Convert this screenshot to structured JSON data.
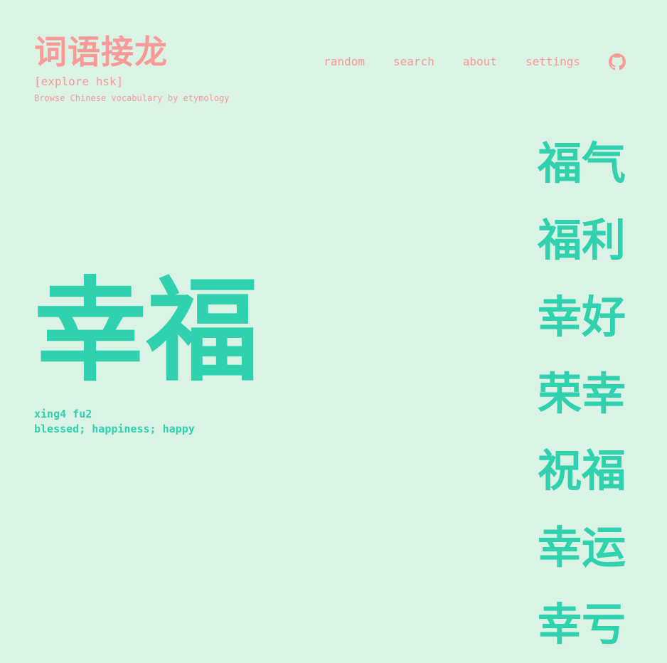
{
  "header": {
    "title": "词语接龙",
    "subtitle": "[explore hsk]",
    "tagline": "Browse Chinese vocabulary by etymology"
  },
  "nav": {
    "items": [
      {
        "label": "random"
      },
      {
        "label": "search"
      },
      {
        "label": "about"
      },
      {
        "label": "settings"
      }
    ],
    "github_icon": "github-icon"
  },
  "word": {
    "characters": "幸福",
    "pinyin": "xing4 fu2",
    "definition": "blessed; happiness; happy"
  },
  "related_words": [
    {
      "word": "福气"
    },
    {
      "word": "福利"
    },
    {
      "word": "幸好"
    },
    {
      "word": "荣幸"
    },
    {
      "word": "祝福"
    },
    {
      "word": "幸运"
    },
    {
      "word": "幸亏"
    }
  ],
  "colors": {
    "background": "#daf3e5",
    "accent_pink": "#f79a98",
    "accent_teal": "#2fd1ae"
  }
}
